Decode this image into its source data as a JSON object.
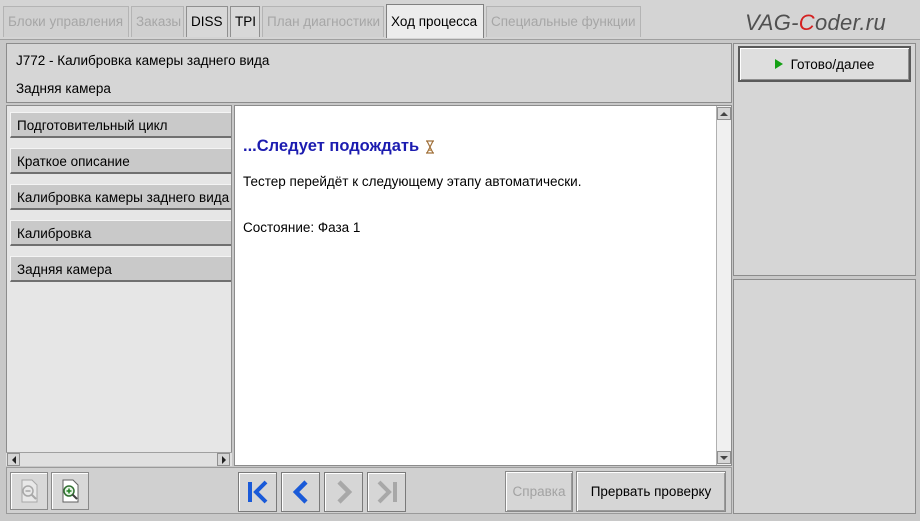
{
  "tabs": [
    {
      "label": "Блоки управления",
      "state": "disabled"
    },
    {
      "label": "Заказы",
      "state": "disabled"
    },
    {
      "label": "DISS",
      "state": "enabled"
    },
    {
      "label": "TPI",
      "state": "enabled"
    },
    {
      "label": "План диагностики",
      "state": "disabled"
    },
    {
      "label": "Ход процесса",
      "state": "active"
    },
    {
      "label": "Специальные функции",
      "state": "disabled"
    }
  ],
  "watermark": {
    "pre": "VAG-",
    "accent": "C",
    "post": "oder.ru"
  },
  "header": {
    "title": "J772 - Калибровка камеры заднего вида",
    "subtitle": "Задняя камера"
  },
  "steps": [
    {
      "label": "Подготовительный цикл"
    },
    {
      "label": "Краткое описание"
    },
    {
      "label": "Калибровка камеры заднего вида"
    },
    {
      "label": "Калибровка"
    },
    {
      "label": "Задняя камера"
    }
  ],
  "content": {
    "wait_title": "...Следует подождать",
    "message": "Тестер перейдёт к следующему этапу автоматически.",
    "status": "Состояние: Фаза 1"
  },
  "right_panel": {
    "done_label": "Готово/далее"
  },
  "bottom": {
    "help_label": "Справка",
    "abort_label": "Прервать проверку"
  },
  "colors": {
    "title_blue": "#1c1cb0",
    "nav_blue": "#1a5ad8",
    "play_green": "#14a014",
    "watermark_red": "#d42020"
  }
}
